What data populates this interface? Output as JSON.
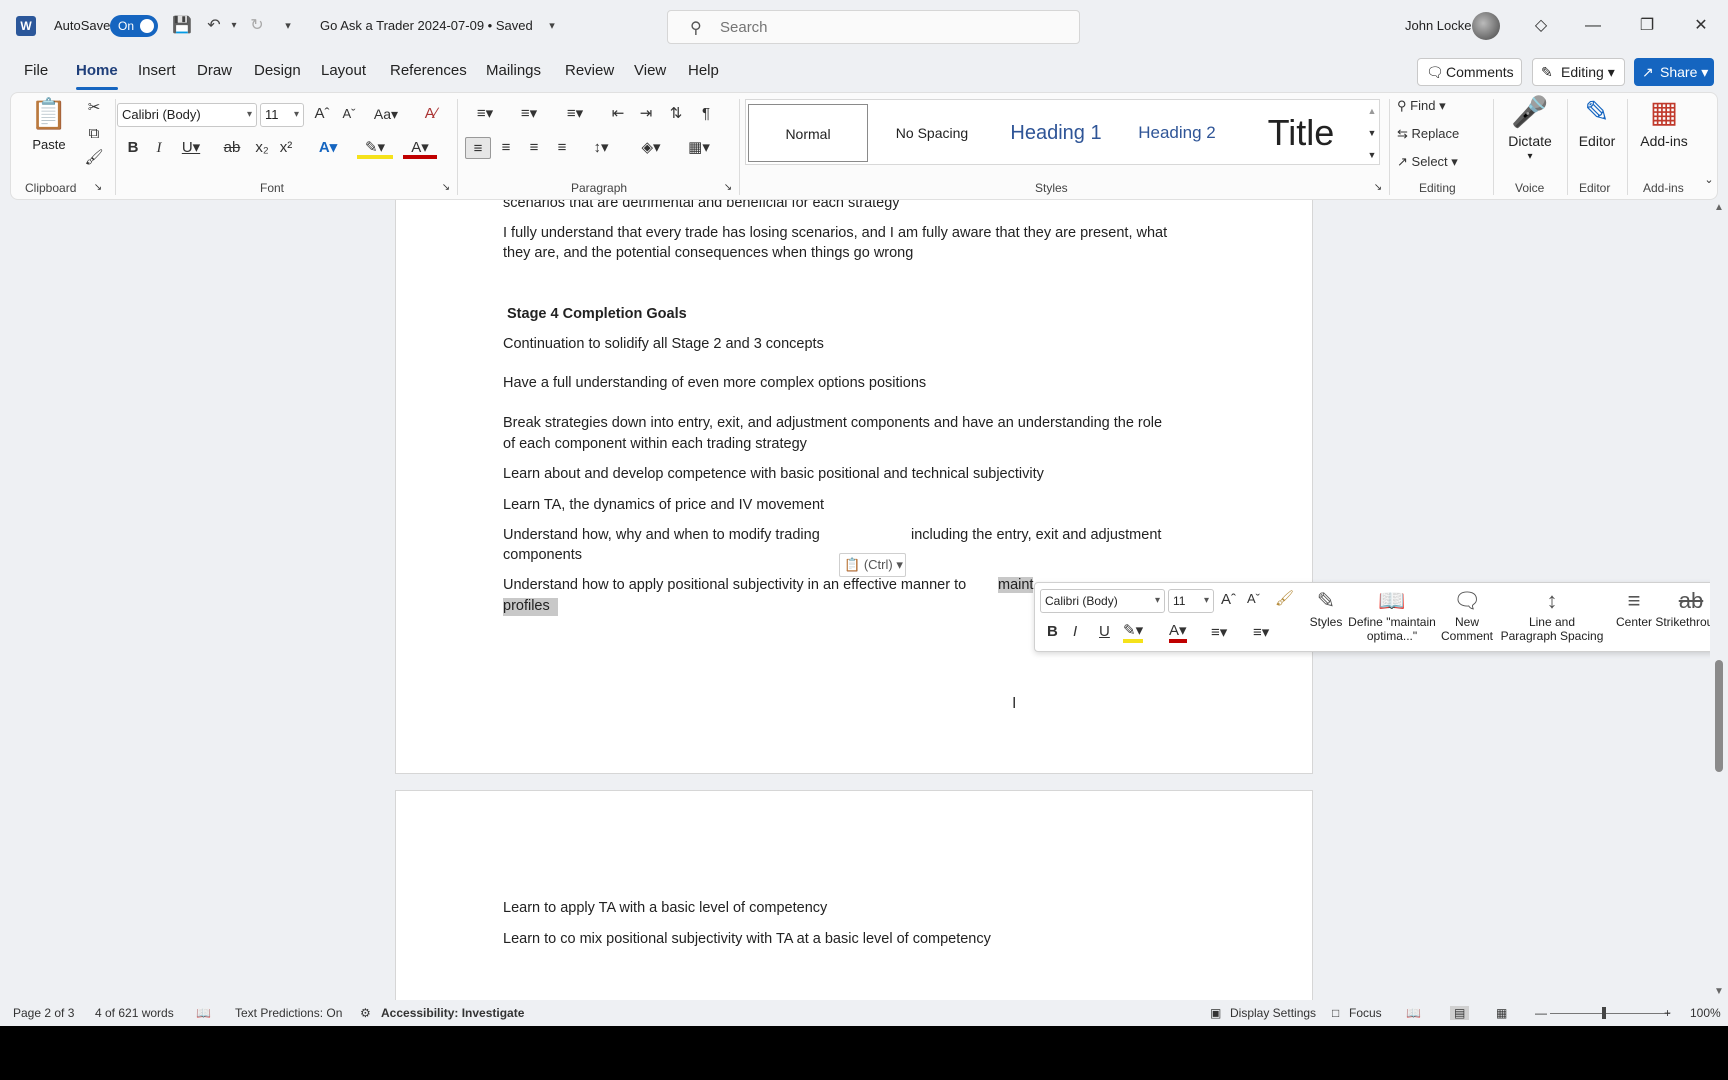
{
  "titlebar": {
    "autosave_label": "AutoSave",
    "autosave_state": "On",
    "doc_title": "Go Ask a Trader 2024-07-09 • Saved",
    "search_placeholder": "Search",
    "user_name": "John Locke"
  },
  "menu": {
    "tabs": [
      "File",
      "Home",
      "Insert",
      "Draw",
      "Design",
      "Layout",
      "References",
      "Mailings",
      "Review",
      "View",
      "Help"
    ],
    "active": "Home",
    "comments_label": "Comments",
    "editing_label": "Editing",
    "share_label": "Share"
  },
  "ribbon": {
    "clipboard": {
      "paste_label": "Paste",
      "group_label": "Clipboard"
    },
    "font": {
      "font_name": "Calibri (Body)",
      "font_size": "11",
      "group_label": "Font"
    },
    "paragraph": {
      "group_label": "Paragraph"
    },
    "styles": {
      "items": [
        "Normal",
        "No Spacing",
        "Heading 1",
        "Heading 2",
        "Title"
      ],
      "group_label": "Styles"
    },
    "editing": {
      "find": "Find",
      "replace": "Replace",
      "select": "Select",
      "group_label": "Editing"
    },
    "voice": {
      "dictate": "Dictate",
      "group_label": "Voice"
    },
    "editor": {
      "label": "Editor",
      "group_label": "Editor"
    },
    "addins": {
      "label": "Add-ins",
      "group_label": "Add-ins"
    }
  },
  "document": {
    "page1_lines": [
      "scenarios that are detrimental and beneficial for each strategy",
      "I fully understand that every trade has losing scenarios, and I am fully aware that they are present, what",
      "they are, and the potential consequences when things go wrong",
      "Stage 4 Completion Goals",
      "Continuation to solidify all Stage 2 and 3 concepts",
      "Have a full understanding of even more complex options positions",
      "Break strategies down into entry, exit, and adjustment components and have an understanding the role",
      "of each component within each trading strategy",
      "Learn about and develop competence with basic positional and technical subjectivity",
      "Learn TA, the dynamics of price and IV movement",
      "Understand how, why and when to modify trading",
      "including the entry, exit and adjustment",
      "components",
      "Understand how to apply positional subjectivity in an effective manner to",
      "maint",
      "profiles"
    ],
    "page2_lines": [
      "Learn to apply TA with a basic level of competency",
      "Learn to co mix positional subjectivity with TA at a basic level of competency"
    ],
    "paste_ctrl": "(Ctrl)"
  },
  "mini_toolbar": {
    "font_name": "Calibri (Body)",
    "font_size": "11",
    "styles": "Styles",
    "define_1": "Define \"maintain",
    "define_2": "optima...\"",
    "new_1": "New",
    "new_2": "Comment",
    "spacing_1": "Line and",
    "spacing_2": "Paragraph Spacing",
    "center": "Center",
    "strike": "Strikethrough"
  },
  "statusbar": {
    "page": "Page 2 of 3",
    "words": "4 of 621 words",
    "predictions": "Text Predictions: On",
    "accessibility": "Accessibility: Investigate",
    "display": "Display Settings",
    "focus": "Focus",
    "zoom": "100%"
  },
  "colors": {
    "accent": "#1565c0",
    "selection": "#c8c8c8",
    "highlight": "#f5e21b",
    "font_color": "#c00000"
  }
}
